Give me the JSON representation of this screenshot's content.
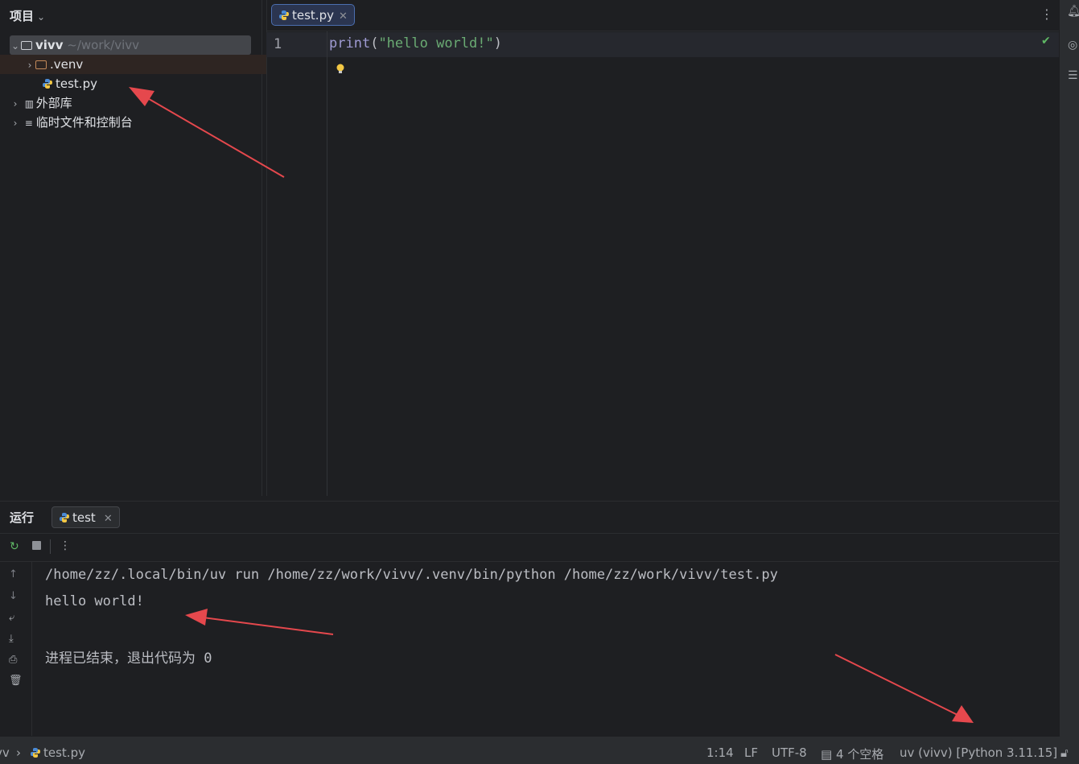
{
  "project_panel": {
    "title": "项目",
    "root": {
      "name": "vivv",
      "path": "~/work/vivv"
    },
    "items": [
      {
        "label": ".venv"
      },
      {
        "label": "test.py"
      },
      {
        "label": "外部库"
      },
      {
        "label": "临时文件和控制台"
      }
    ]
  },
  "editor": {
    "tab_label": "test.py",
    "line_number": "1",
    "code": {
      "fn": "print",
      "open": "(",
      "str": "\"hello world!\"",
      "close": ")"
    }
  },
  "run_panel": {
    "title": "运行",
    "tab_label": "test",
    "console_lines": [
      "/home/zz/.local/bin/uv run /home/zz/work/vivv/.venv/bin/python /home/zz/work/vivv/test.py",
      "hello world!",
      "进程已结束，退出代码为 0"
    ]
  },
  "status_bar": {
    "breadcrumb_root": "vv",
    "breadcrumb_file": "test.py",
    "position": "1:14",
    "line_sep": "LF",
    "encoding": "UTF-8",
    "indent": "4 个空格",
    "interpreter": "uv (vivv) [Python 3.11.15]"
  },
  "colors": {
    "background": "#1e1f22",
    "panel": "#2b2d30",
    "accent": "#4b6eaf",
    "annotation_arrow": "#e5484d"
  }
}
